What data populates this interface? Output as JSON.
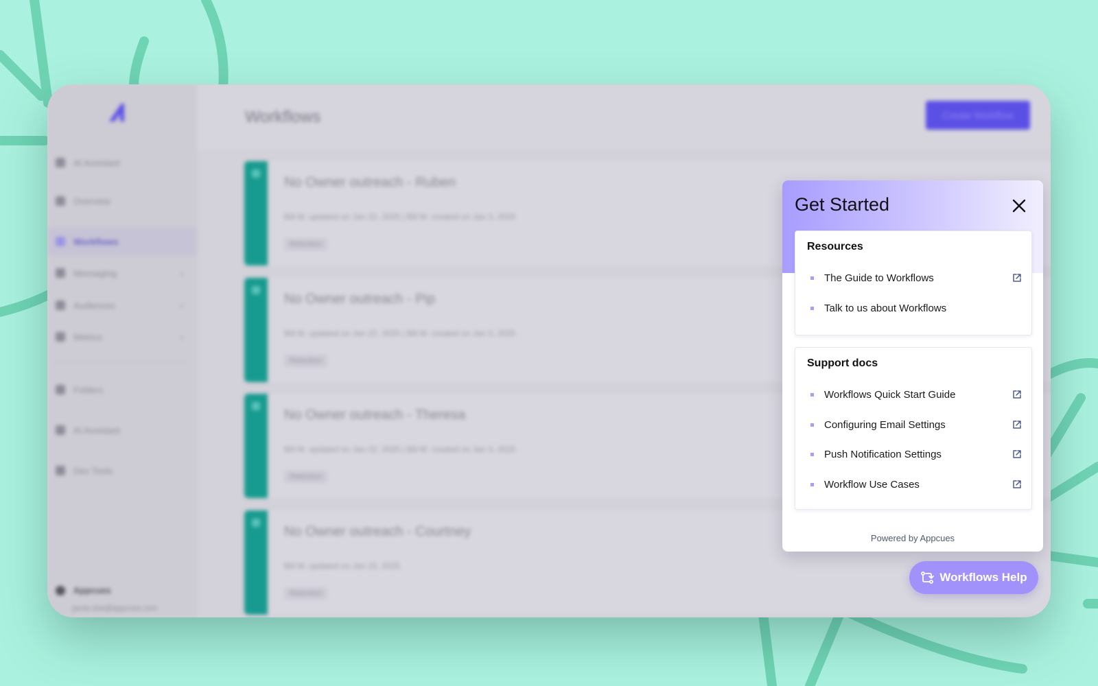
{
  "app": {
    "page_title": "Workflows",
    "create_label": "Create Workflow",
    "sidebar": {
      "items": [
        {
          "label": "AI Assistant"
        },
        {
          "label": "Overview"
        },
        {
          "label": "Workflows"
        },
        {
          "label": "Messaging"
        },
        {
          "label": "Audiences"
        },
        {
          "label": "Metrics"
        },
        {
          "label": "Folders"
        },
        {
          "label": "AI Assistant"
        },
        {
          "label": "Dev Tools"
        }
      ],
      "account": "Appcues",
      "email": "jamie.doe@appcues.com"
    },
    "workflows": [
      {
        "title": "No Owner outreach - Ruben",
        "meta": "Bill M. updated on Jan 22, 2025  |  Bill M. created on Jan 3, 2025",
        "tag": "Retention"
      },
      {
        "title": "No Owner outreach - Pip",
        "meta": "Bill M. updated on Jan 22, 2025  |  Bill M. created on Jan 3, 2025",
        "tag": "Retention"
      },
      {
        "title": "No Owner outreach - Theresa",
        "meta": "Bill M. updated on Jan 22, 2025  |  Bill M. created on Jan 3, 2025",
        "tag": "Retention"
      },
      {
        "title": "No Owner outreach - Courtney",
        "meta": "Bill M. updated on Jan 22, 2025",
        "tag": "Retention"
      }
    ]
  },
  "panel": {
    "title": "Get Started",
    "resources": {
      "title": "Resources",
      "items": [
        {
          "label": "The Guide to Workflows",
          "external": true
        },
        {
          "label": "Talk to us about Workflows",
          "external": false
        }
      ]
    },
    "support_docs": {
      "title": "Support docs",
      "items": [
        {
          "label": "Workflows Quick Start Guide",
          "external": true
        },
        {
          "label": "Configuring Email Settings",
          "external": true
        },
        {
          "label": "Push Notification Settings",
          "external": true
        },
        {
          "label": "Workflow Use Cases",
          "external": true
        }
      ]
    },
    "powered_by": "Powered by Appcues"
  },
  "launcher": {
    "label": "Workflows Help"
  },
  "colors": {
    "background": "#aaf2df",
    "accent": "#a192fb",
    "workflow_strip": "#179a8f",
    "brand_primary": "#5b50e6"
  }
}
